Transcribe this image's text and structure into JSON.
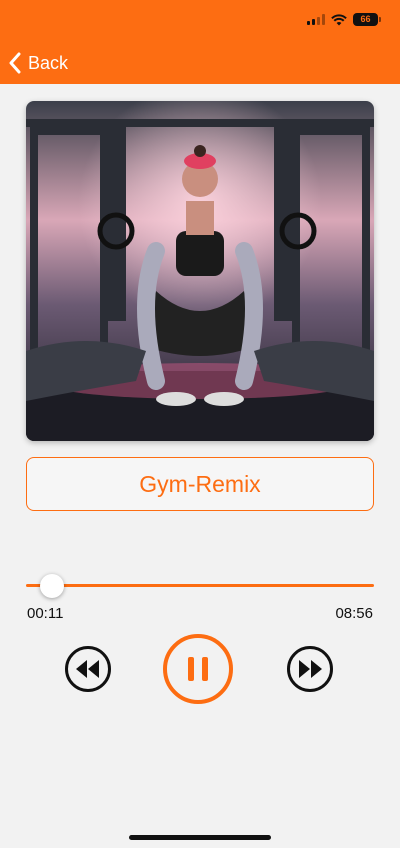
{
  "status_bar": {
    "time": "",
    "battery": "66"
  },
  "nav": {
    "back_label": "Back"
  },
  "track": {
    "title": "Gym-Remix",
    "elapsed": "00:11",
    "duration": "08:56",
    "progress_fraction": 0.02
  },
  "theme": {
    "accent": "#fd6d12",
    "background": "#f2f2f2"
  },
  "icons": {
    "back": "chevron-left-icon",
    "rewind": "rewind-icon",
    "pause": "pause-icon",
    "forward": "fast-forward-icon"
  }
}
